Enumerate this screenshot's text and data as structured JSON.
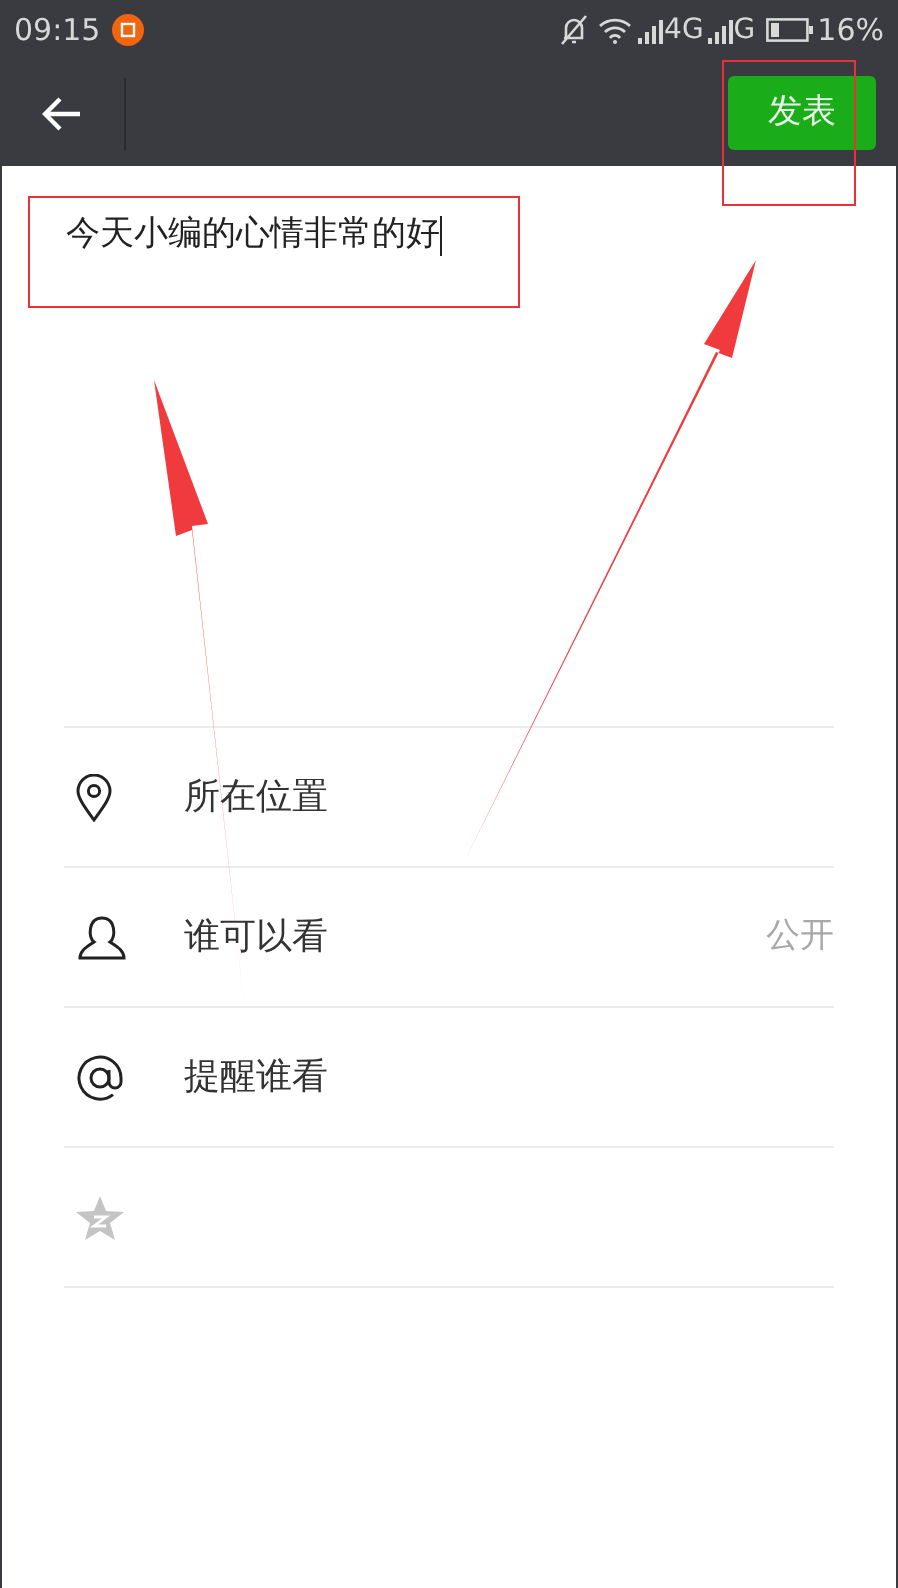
{
  "status_bar": {
    "time": "09:15",
    "network_1": "4G",
    "network_2": "G",
    "battery": "16%"
  },
  "nav": {
    "publish_button": "发表"
  },
  "post": {
    "value": "今天小编的心情非常的好"
  },
  "options": [
    {
      "kind": "location",
      "label": "所在位置"
    },
    {
      "kind": "visibility",
      "label": "谁可以看",
      "value": "公开"
    },
    {
      "kind": "mention",
      "label": "提醒谁看"
    },
    {
      "kind": "share"
    }
  ]
}
